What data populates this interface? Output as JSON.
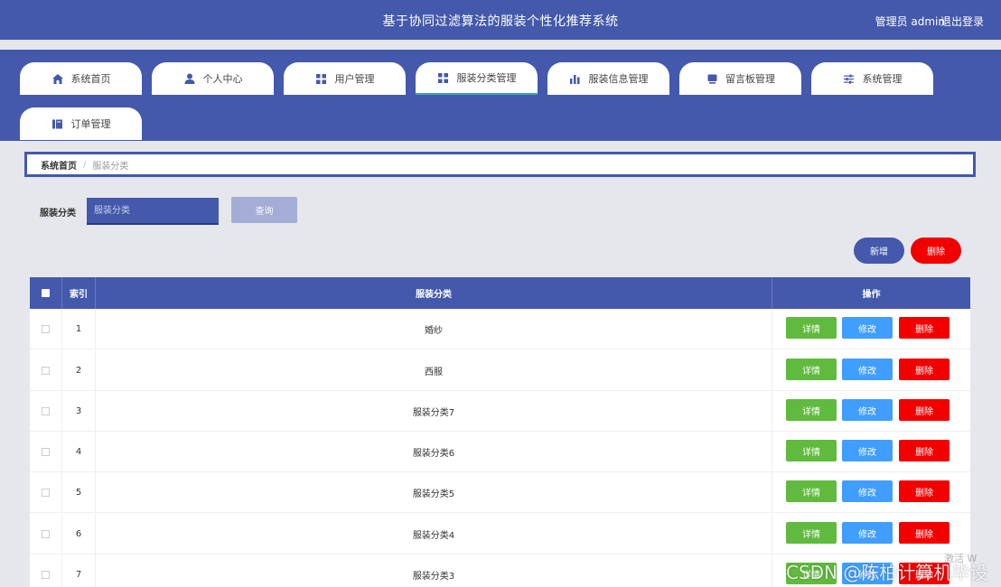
{
  "header": {
    "title": "基于协同过滤算法的服装个性化推荐系统",
    "user": "管理员 admin",
    "logout": "退出登录"
  },
  "nav": {
    "tabs": [
      {
        "label": "系统首页",
        "icon": "home-icon"
      },
      {
        "label": "个人中心",
        "icon": "user-icon"
      },
      {
        "label": "用户管理",
        "icon": "grid-icon"
      },
      {
        "label": "服装分类管理",
        "icon": "grid-icon",
        "active": true
      },
      {
        "label": "服装信息管理",
        "icon": "bar-chart-icon"
      },
      {
        "label": "留言板管理",
        "icon": "message-icon"
      },
      {
        "label": "系统管理",
        "icon": "sliders-icon"
      },
      {
        "label": "订单管理",
        "icon": "book-icon"
      }
    ]
  },
  "breadcrumb": {
    "home": "系统首页",
    "separator": "/",
    "current": "服装分类"
  },
  "search": {
    "label": "服装分类",
    "placeholder": "服装分类",
    "button": "查询"
  },
  "actions": {
    "add": "新增",
    "delete": "删除"
  },
  "table": {
    "headers": [
      "索引",
      "服装分类",
      "操作"
    ],
    "rows": [
      {
        "index": "1",
        "name": "婚纱"
      },
      {
        "index": "2",
        "name": "西服"
      },
      {
        "index": "3",
        "name": "服装分类7"
      },
      {
        "index": "4",
        "name": "服装分类6"
      },
      {
        "index": "5",
        "name": "服装分类5"
      },
      {
        "index": "6",
        "name": "服装分类4"
      },
      {
        "index": "7",
        "name": "服装分类3"
      }
    ],
    "row_actions": {
      "detail": "详情",
      "edit": "修改",
      "remove": "删除"
    }
  },
  "watermark": {
    "text": "CSDN @陈柏计算机毕设",
    "text2": "激活 W"
  },
  "colors": {
    "primary": "#4459ac",
    "detail": "#5fba3d",
    "edit": "#409eff",
    "danger": "#f20000"
  }
}
